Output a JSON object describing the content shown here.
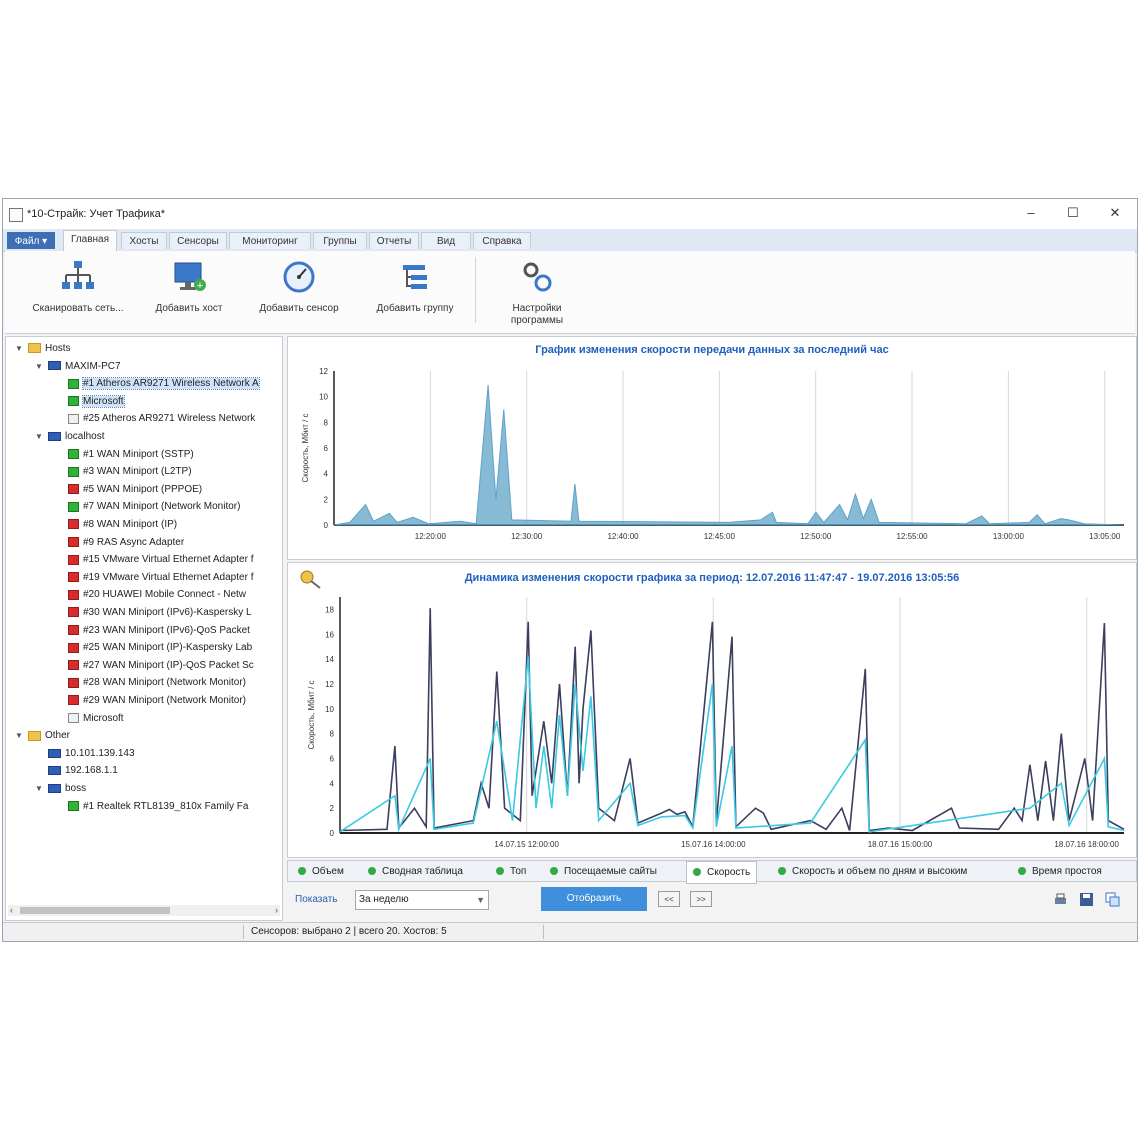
{
  "window": {
    "title": "*10-Страйк: Учет Трафика*",
    "minimize": "–",
    "maximize": "☐",
    "close": "✕"
  },
  "ribbon_tabs": [
    {
      "label": "Файл ▾",
      "kind": "file"
    },
    {
      "label": "Главная",
      "kind": "active"
    },
    {
      "label": "Хосты"
    },
    {
      "label": "Сенсоры"
    },
    {
      "label": "Мониторинг"
    },
    {
      "label": "Группы"
    },
    {
      "label": "Отчеты"
    },
    {
      "label": "Вид"
    },
    {
      "label": "Справка"
    }
  ],
  "ribbon": {
    "scan_network": "Сканировать сеть...",
    "add_host": "Добавить хост",
    "add_sensor": "Добавить сенсор",
    "add_group": "Добавить группу",
    "settings_line1": "Настройки",
    "settings_line2": "программы"
  },
  "tree": [
    {
      "level": 0,
      "twisty": "▼",
      "icon": "folder",
      "label": "Hosts"
    },
    {
      "level": 1,
      "twisty": "▼",
      "icon": "host",
      "label": "MAXIM-PC7"
    },
    {
      "level": 2,
      "icon": "green",
      "label": "#1 Atheros AR9271 Wireless Network A",
      "selected": true
    },
    {
      "level": 2,
      "icon": "green",
      "label": "Microsoft",
      "selected": true
    },
    {
      "level": 2,
      "icon": "gray",
      "label": "#25 Atheros AR9271 Wireless Network"
    },
    {
      "level": 1,
      "twisty": "▼",
      "icon": "host",
      "label": "localhost"
    },
    {
      "level": 2,
      "icon": "green",
      "label": "#1 WAN Miniport (SSTP)"
    },
    {
      "level": 2,
      "icon": "green",
      "label": "#3 WAN Miniport (L2TP)"
    },
    {
      "level": 2,
      "icon": "red",
      "label": "#5 WAN Miniport (PPPOE)"
    },
    {
      "level": 2,
      "icon": "green",
      "label": "#7 WAN Miniport (Network Monitor)"
    },
    {
      "level": 2,
      "icon": "red",
      "label": "#8 WAN Miniport (IP)"
    },
    {
      "level": 2,
      "icon": "red",
      "label": "#9 RAS Async Adapter"
    },
    {
      "level": 2,
      "icon": "red",
      "label": "#15 VMware Virtual Ethernet Adapter f"
    },
    {
      "level": 2,
      "icon": "red",
      "label": "#19 VMware Virtual Ethernet Adapter f"
    },
    {
      "level": 2,
      "icon": "red",
      "label": "#20 HUAWEI Mobile Connect - Netw"
    },
    {
      "level": 2,
      "icon": "red",
      "label": "#30 WAN Miniport (IPv6)-Kaspersky L"
    },
    {
      "level": 2,
      "icon": "red",
      "label": "#23 WAN Miniport (IPv6)-QoS Packet"
    },
    {
      "level": 2,
      "icon": "red",
      "label": "#25 WAN Miniport (IP)-Kaspersky Lab"
    },
    {
      "level": 2,
      "icon": "red",
      "label": "#27 WAN Miniport (IP)-QoS Packet Sc"
    },
    {
      "level": 2,
      "icon": "red",
      "label": "#28 WAN Miniport (Network Monitor)"
    },
    {
      "level": 2,
      "icon": "red",
      "label": "#29 WAN Miniport (Network Monitor)"
    },
    {
      "level": 2,
      "icon": "gray",
      "label": "Microsoft"
    },
    {
      "level": 0,
      "twisty": "▼",
      "icon": "folder",
      "label": "Other"
    },
    {
      "level": 1,
      "icon": "host",
      "label": "10.101.139.143"
    },
    {
      "level": 1,
      "icon": "host",
      "label": "192.168.1.1"
    },
    {
      "level": 1,
      "twisty": "▼",
      "icon": "host",
      "label": "boss"
    },
    {
      "level": 2,
      "icon": "green",
      "label": "#1 Realtek RTL8139_810x Family Fa"
    }
  ],
  "charts": [
    {
      "title": "График изменения скорости передачи данных за последний час",
      "ylabel": "Скорость, Мбит / с",
      "chart_data": {
        "type": "area",
        "title": "График изменения скорости передачи данных за последний час",
        "ylabel": "Скорость, Мбит / с",
        "ylim": [
          0,
          12
        ],
        "yticks": [
          "0",
          "2",
          "4",
          "6",
          "8",
          "10",
          "12"
        ],
        "xticks": [
          "12:20:00",
          "12:30:00",
          "12:40:00",
          "12:45:00",
          "12:50:00",
          "12:55:00",
          "13:00:00",
          "13:05:00"
        ],
        "series": [
          {
            "color": "#5fa3c7",
            "points": [
              [
                0.0,
                0.0
              ],
              [
                0.02,
                0.2
              ],
              [
                0.04,
                1.6
              ],
              [
                0.05,
                0.3
              ],
              [
                0.07,
                0.9
              ],
              [
                0.08,
                0.2
              ],
              [
                0.1,
                0.6
              ],
              [
                0.12,
                0.1
              ],
              [
                0.16,
                0.3
              ],
              [
                0.18,
                0.1
              ],
              [
                0.195,
                10.9
              ],
              [
                0.205,
                2.0
              ],
              [
                0.215,
                9.0
              ],
              [
                0.225,
                0.4
              ],
              [
                0.3,
                0.3
              ],
              [
                0.305,
                3.2
              ],
              [
                0.31,
                0.3
              ],
              [
                0.5,
                0.2
              ],
              [
                0.54,
                0.4
              ],
              [
                0.555,
                1.0
              ],
              [
                0.56,
                0.2
              ],
              [
                0.6,
                0.1
              ],
              [
                0.61,
                1.0
              ],
              [
                0.62,
                0.2
              ],
              [
                0.64,
                1.6
              ],
              [
                0.65,
                0.4
              ],
              [
                0.66,
                2.4
              ],
              [
                0.67,
                0.5
              ],
              [
                0.68,
                2.0
              ],
              [
                0.69,
                0.2
              ],
              [
                0.8,
                0.1
              ],
              [
                0.82,
                0.7
              ],
              [
                0.83,
                0.1
              ],
              [
                0.88,
                0.2
              ],
              [
                0.89,
                0.8
              ],
              [
                0.9,
                0.1
              ],
              [
                0.92,
                0.5
              ],
              [
                0.93,
                0.4
              ],
              [
                0.95,
                0.1
              ],
              [
                1.0,
                0.0
              ]
            ]
          }
        ]
      }
    },
    {
      "title": "Динамика изменения скорости графика за период: 12.07.2016 11:47:47 - 19.07.2016 13:05:56",
      "ylabel": "Скорость, Мбит / с",
      "chart_data": {
        "type": "line",
        "title": "Динамика изменения скорости графика за период: 12.07.2016 11:47:47 - 19.07.2016 13:05:56",
        "ylabel": "Скорость, Мбит / с",
        "ylim": [
          0,
          19
        ],
        "yticks": [
          "0",
          "2",
          "4",
          "6",
          "8",
          "10",
          "12",
          "14",
          "16",
          "18"
        ],
        "xticks": [
          "14.07.15 12:00:00",
          "15.07.16 14:00:00",
          "18.07.16 15:00:00",
          "18.07.16 18:00:00"
        ],
        "series": [
          {
            "color": "#3b3f5e",
            "points": [
              [
                0.0,
                0.2
              ],
              [
                0.06,
                0.3
              ],
              [
                0.07,
                7.0
              ],
              [
                0.075,
                0.4
              ],
              [
                0.095,
                2.0
              ],
              [
                0.11,
                0.5
              ],
              [
                0.115,
                18.1
              ],
              [
                0.12,
                0.4
              ],
              [
                0.17,
                1.0
              ],
              [
                0.18,
                4.0
              ],
              [
                0.19,
                2.0
              ],
              [
                0.2,
                13.0
              ],
              [
                0.21,
                2.0
              ],
              [
                0.23,
                1.0
              ],
              [
                0.24,
                17.0
              ],
              [
                0.245,
                3.0
              ],
              [
                0.26,
                9.0
              ],
              [
                0.27,
                4.0
              ],
              [
                0.28,
                12.0
              ],
              [
                0.29,
                3.0
              ],
              [
                0.3,
                15.0
              ],
              [
                0.305,
                4.0
              ],
              [
                0.31,
                10.0
              ],
              [
                0.32,
                16.3
              ],
              [
                0.33,
                2.0
              ],
              [
                0.35,
                1.0
              ],
              [
                0.37,
                6.0
              ],
              [
                0.38,
                0.8
              ],
              [
                0.41,
                1.6
              ],
              [
                0.42,
                1.9
              ],
              [
                0.43,
                1.5
              ],
              [
                0.44,
                1.7
              ],
              [
                0.45,
                0.5
              ],
              [
                0.475,
                17.0
              ],
              [
                0.48,
                0.8
              ],
              [
                0.5,
                15.8
              ],
              [
                0.505,
                0.5
              ],
              [
                0.53,
                2.0
              ],
              [
                0.54,
                1.6
              ],
              [
                0.55,
                0.3
              ],
              [
                0.6,
                1.0
              ],
              [
                0.62,
                0.3
              ],
              [
                0.64,
                2.0
              ],
              [
                0.65,
                0.2
              ],
              [
                0.67,
                13.2
              ],
              [
                0.675,
                0.2
              ],
              [
                0.7,
                0.4
              ],
              [
                0.73,
                0.2
              ],
              [
                0.78,
                2.0
              ],
              [
                0.79,
                0.4
              ],
              [
                0.84,
                0.3
              ],
              [
                0.86,
                2.0
              ],
              [
                0.87,
                1.0
              ],
              [
                0.88,
                5.5
              ],
              [
                0.89,
                1.0
              ],
              [
                0.9,
                5.8
              ],
              [
                0.91,
                1.0
              ],
              [
                0.92,
                8.0
              ],
              [
                0.93,
                1.0
              ],
              [
                0.95,
                6.0
              ],
              [
                0.96,
                1.0
              ],
              [
                0.975,
                16.9
              ],
              [
                0.98,
                1.0
              ],
              [
                1.0,
                0.3
              ]
            ]
          },
          {
            "color": "#3bc9e3",
            "points": [
              [
                0.0,
                0.1
              ],
              [
                0.07,
                3.0
              ],
              [
                0.075,
                0.3
              ],
              [
                0.115,
                6.0
              ],
              [
                0.12,
                0.3
              ],
              [
                0.17,
                0.8
              ],
              [
                0.2,
                9.0
              ],
              [
                0.22,
                1.0
              ],
              [
                0.24,
                14.2
              ],
              [
                0.25,
                2.0
              ],
              [
                0.26,
                7.0
              ],
              [
                0.27,
                2.0
              ],
              [
                0.28,
                9.5
              ],
              [
                0.29,
                3.0
              ],
              [
                0.3,
                12.0
              ],
              [
                0.31,
                5.0
              ],
              [
                0.32,
                11.0
              ],
              [
                0.33,
                1.0
              ],
              [
                0.37,
                4.0
              ],
              [
                0.38,
                0.6
              ],
              [
                0.41,
                1.3
              ],
              [
                0.44,
                1.4
              ],
              [
                0.45,
                0.4
              ],
              [
                0.475,
                12.0
              ],
              [
                0.48,
                0.5
              ],
              [
                0.5,
                7.0
              ],
              [
                0.505,
                0.4
              ],
              [
                0.6,
                0.8
              ],
              [
                0.67,
                7.5
              ],
              [
                0.675,
                0.1
              ],
              [
                0.88,
                2.0
              ],
              [
                0.92,
                4.0
              ],
              [
                0.93,
                0.6
              ],
              [
                0.975,
                6.0
              ],
              [
                0.98,
                0.5
              ],
              [
                1.0,
                0.2
              ]
            ]
          }
        ]
      }
    }
  ],
  "report_tabs": [
    {
      "label": "Объем"
    },
    {
      "label": "Сводная таблица"
    },
    {
      "label": "Топ"
    },
    {
      "label": "Посещаемые сайты"
    },
    {
      "label": "Скорость",
      "active": true
    },
    {
      "label": "Скорость и объем по дням и  высоким"
    },
    {
      "label": "Время простоя"
    }
  ],
  "controls": {
    "show_label": "Показать",
    "period_value": "За неделю",
    "show_button": "Отобразить",
    "prev": "<<",
    "next": ">>"
  },
  "status": {
    "text": "Сенсоров: выбрано 2 | всего 20. Хостов: 5"
  }
}
